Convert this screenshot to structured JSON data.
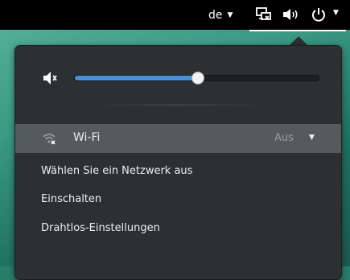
{
  "topbar": {
    "language": "de",
    "icons": [
      "network-disconnected-icon",
      "speaker-volume-icon",
      "power-icon"
    ]
  },
  "volume": {
    "level": 0.5,
    "icon": "speaker-muted-icon"
  },
  "wifi": {
    "label": "Wi-Fi",
    "status": "Aus",
    "icon": "wifi-disconnected-icon",
    "items": {
      "select_network": "Wählen Sie ein Netzwerk aus",
      "turn_on": "Einschalten",
      "settings": "Drahtlos-Einstellungen"
    }
  },
  "colors": {
    "accent": "#4a90d9",
    "menu_bg": "#2d3032",
    "highlight": "#555a5d"
  }
}
